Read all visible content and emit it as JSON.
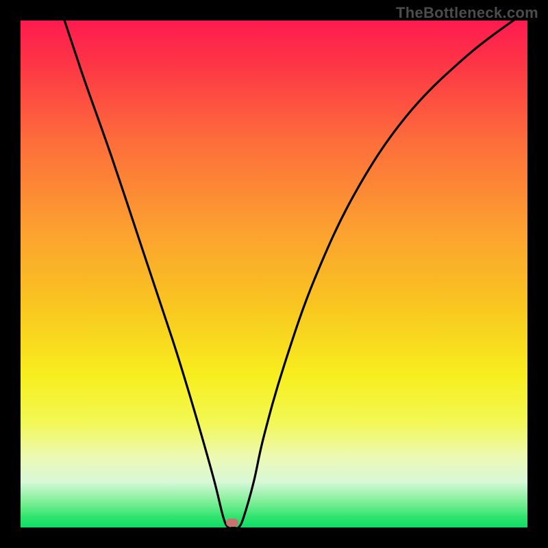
{
  "watermark": "TheBottleneck.com",
  "chart_data": {
    "type": "line",
    "title": "",
    "xlabel": "",
    "ylabel": "",
    "axes_visible": false,
    "grid": false,
    "background_gradient": {
      "top_color": "#fe1b4f",
      "bottom_color": "#0ddd66",
      "stops": [
        "red",
        "orange",
        "yellow",
        "green"
      ]
    },
    "x_range": [
      0,
      100
    ],
    "y_range": [
      0,
      100
    ],
    "series": [
      {
        "name": "bottleneck-curve",
        "x": [
          0,
          6,
          12,
          18,
          24,
          30,
          34,
          38,
          40,
          41,
          42,
          43,
          44,
          46,
          48,
          52,
          58,
          66,
          76,
          88,
          100
        ],
        "y": [
          125,
          108,
          90,
          73,
          55,
          37,
          24,
          10,
          2,
          0,
          0,
          0,
          2,
          9,
          18,
          32,
          49,
          66,
          81,
          93,
          102
        ]
      }
    ],
    "marker": {
      "x_pct": 41.8,
      "y_pct": 99.0,
      "color": "#ca736e"
    }
  }
}
